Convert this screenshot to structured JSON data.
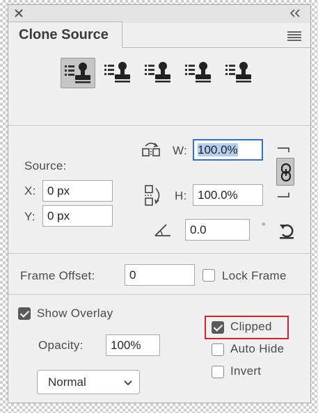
{
  "panel": {
    "tab_title": "Clone Source",
    "close_icon": "close-icon",
    "collapse_icon": "double-chevron-icon",
    "menu_icon": "hamburger-menu-icon"
  },
  "sources": {
    "buttons": [
      "clone-source-1",
      "clone-source-2",
      "clone-source-3",
      "clone-source-4",
      "clone-source-5"
    ],
    "active_index": 0
  },
  "source": {
    "label": "Source:",
    "x_label": "X:",
    "x_value": "0 px",
    "y_label": "Y:",
    "y_value": "0 px"
  },
  "scale": {
    "w_label": "W:",
    "w_value": "100.0%",
    "h_label": "H:",
    "h_value": "100.0%",
    "angle_value": "0.0",
    "degree_symbol": "°",
    "link_icon": "chain-link-icon",
    "reset_icon": "reset-transform-icon"
  },
  "frame": {
    "offset_label": "Frame Offset:",
    "offset_value": "0",
    "lock_frame_label": "Lock Frame",
    "lock_frame_checked": false
  },
  "overlay": {
    "show_label": "Show Overlay",
    "show_checked": true,
    "opacity_label": "Opacity:",
    "opacity_value": "100%",
    "clipped_label": "Clipped",
    "clipped_checked": true,
    "auto_hide_label": "Auto Hide",
    "auto_hide_checked": false,
    "invert_label": "Invert",
    "invert_checked": false,
    "blend_mode": "Normal"
  },
  "colors": {
    "panel_bg": "#f0f0f0",
    "focus_border": "#2f6fd6",
    "highlight_border": "#d4232a"
  }
}
